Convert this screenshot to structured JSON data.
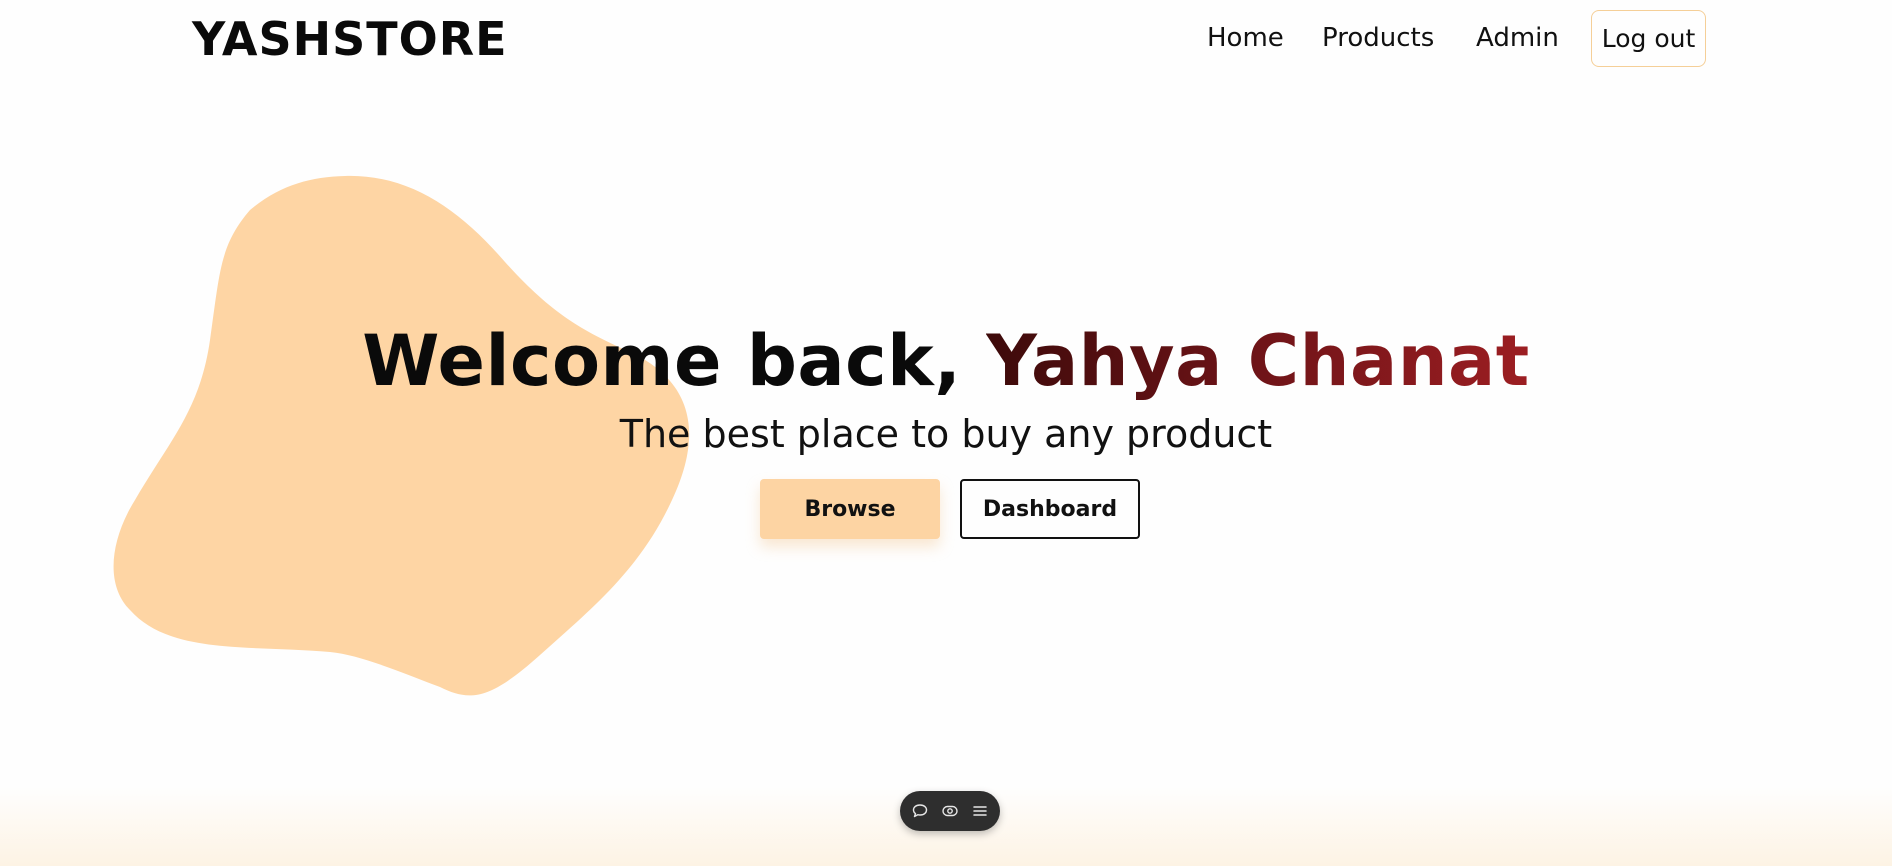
{
  "brand": {
    "name": "YASHSTORE"
  },
  "nav": {
    "items": [
      {
        "label": "Home"
      },
      {
        "label": "Products"
      },
      {
        "label": "Admin"
      }
    ],
    "logout_label": "Log out"
  },
  "hero": {
    "greeting": "Welcome back, ",
    "user_name": "Yahya Chanat",
    "tagline": "The best place to buy any product",
    "browse_label": "Browse",
    "dashboard_label": "Dashboard"
  },
  "toolbar": {
    "icons": [
      "chat-bubble-icon",
      "eye-icon",
      "menu-icon"
    ]
  },
  "colors": {
    "blob": "#fed5a4",
    "accent_dark_red": "#7a151a",
    "browse_bg": "#fdd4a3",
    "logout_border": "#f5cf98",
    "toolbar_bg": "#2e2e2e"
  }
}
